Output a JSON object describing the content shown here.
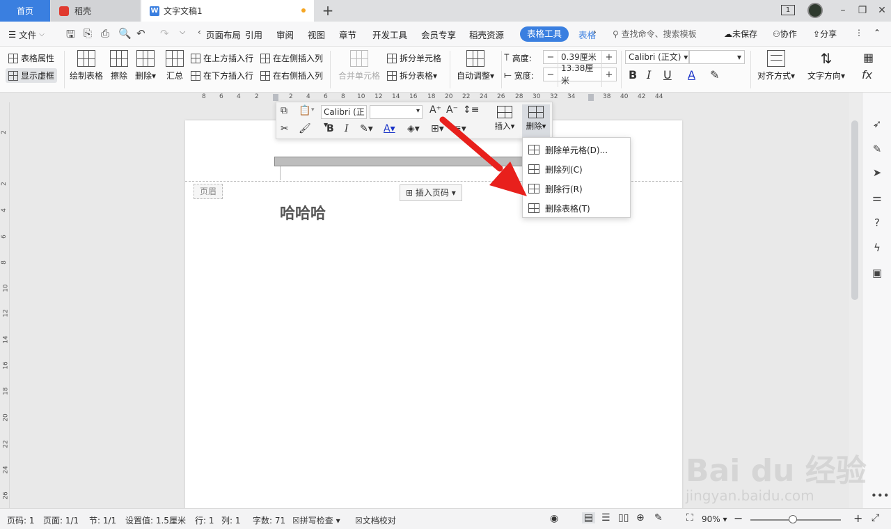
{
  "tabs": {
    "home": "首页",
    "daoke": "稻壳",
    "document": "文字文稿1"
  },
  "titlebar": {
    "page_indicator": "1"
  },
  "menu": {
    "file": "文件",
    "items": [
      "页面布局",
      "引用",
      "审阅",
      "视图",
      "章节",
      "开发工具",
      "会员专享",
      "稻壳资源"
    ],
    "active_tab": "表格工具",
    "next_tab": "表格",
    "search_placeholder": "查找命令、搜索模板",
    "unsaved": "未保存",
    "collaborate": "协作",
    "share": "分享"
  },
  "ribbon": {
    "table_properties": "表格属性",
    "show_gridlines": "显示虚框",
    "draw_table": "绘制表格",
    "erase": "擦除",
    "delete": "删除",
    "summary": "汇总",
    "insert_row_above": "在上方插入行",
    "insert_row_below": "在下方插入行",
    "insert_col_left": "在左侧插入列",
    "insert_col_right": "在右侧插入列",
    "merge_cells": "合并单元格",
    "split_cells": "拆分单元格",
    "split_table": "拆分表格",
    "auto_fit": "自动调整",
    "height_label": "高度:",
    "height_value": "0.39厘米",
    "width_label": "宽度:",
    "width_value": "13.38厘米",
    "font_name": "Calibri (正文)",
    "align": "对齐方式",
    "text_direction": "文字方向"
  },
  "ruler": {
    "h_numbers": [
      "8",
      "6",
      "4",
      "2",
      "2",
      "4",
      "6",
      "8",
      "10",
      "12",
      "14",
      "16",
      "18",
      "20",
      "22",
      "24",
      "26",
      "28",
      "30",
      "32",
      "34",
      "38",
      "40",
      "42",
      "44"
    ],
    "v_numbers": [
      "2",
      "2",
      "4",
      "6",
      "8",
      "10",
      "12",
      "14",
      "16",
      "18",
      "20",
      "22",
      "24",
      "26"
    ]
  },
  "mini_toolbar": {
    "font": "Calibri (正",
    "insert": "插入",
    "delete": "删除"
  },
  "dropdown": {
    "items": [
      "删除单元格(D)...",
      "删除列(C)",
      "删除行(R)",
      "删除表格(T)"
    ]
  },
  "document": {
    "header_label": "页眉",
    "insert_page_number": "插入页码",
    "body_text": "哈哈哈"
  },
  "status": {
    "page_no": "页码: 1",
    "pages": "页面: 1/1",
    "section": "节: 1/1",
    "setting": "设置值: 1.5厘米",
    "row": "行: 1",
    "col": "列: 1",
    "word_count": "字数: 71",
    "spell_check": "拼写检查",
    "proofread": "文档校对",
    "zoom": "90%"
  },
  "watermark": {
    "main": "Bai du 经验",
    "sub": "jingyan.baidu.com"
  },
  "colors": {
    "accent": "#3a7fe0",
    "arrow": "#e8201c",
    "unsaved_dot": "#f5a623"
  }
}
